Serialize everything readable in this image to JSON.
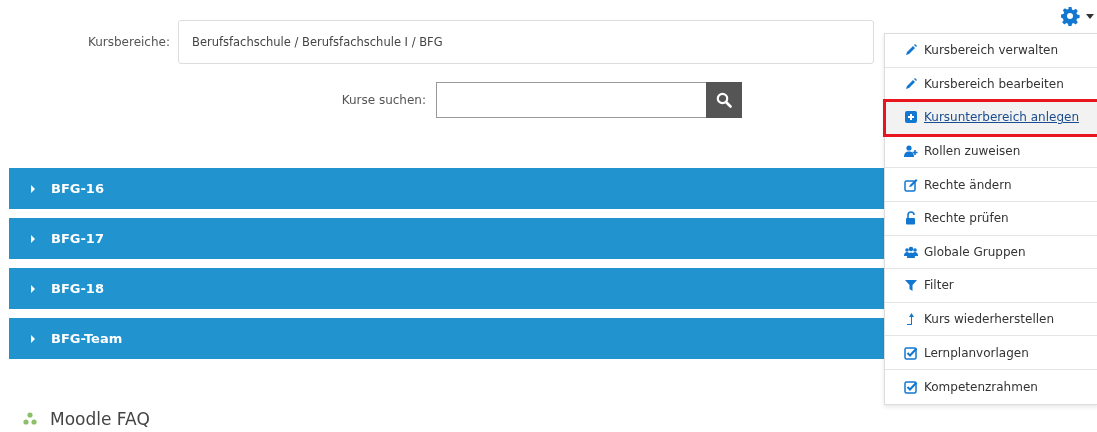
{
  "category_select": {
    "label": "Kursbereiche:",
    "value": "Berufsfachschule / Berufsfachschule I / BFG"
  },
  "course_search": {
    "label": "Kurse suchen:"
  },
  "categories": [
    {
      "name": "BFG-16",
      "expanded": false
    },
    {
      "name": "BFG-17",
      "expanded": false
    },
    {
      "name": "BFG-18",
      "expanded": false
    },
    {
      "name": "BFG-Team",
      "expanded": false
    }
  ],
  "section": {
    "title": "Moodle FAQ"
  },
  "settings_menu": {
    "expanded": true,
    "items": [
      {
        "label": "Kursbereich verwalten",
        "kind": "pencil",
        "highlighted": false
      },
      {
        "label": "Kursbereich bearbeiten",
        "kind": "pencil",
        "highlighted": false
      },
      {
        "label": "Kursunterbereich anlegen",
        "kind": "plus",
        "highlighted": true
      },
      {
        "label": "Rollen zuweisen",
        "kind": "userplus",
        "highlighted": false
      },
      {
        "label": "Rechte ändern",
        "kind": "edit",
        "highlighted": false
      },
      {
        "label": "Rechte prüfen",
        "kind": "unlock",
        "highlighted": false
      },
      {
        "label": "Globale Gruppen",
        "kind": "users",
        "highlighted": false
      },
      {
        "label": "Filter",
        "kind": "filter",
        "highlighted": false
      },
      {
        "label": "Kurs wiederherstellen",
        "kind": "levelup",
        "highlighted": false
      },
      {
        "label": "Lernplanvorlagen",
        "kind": "check",
        "highlighted": false
      },
      {
        "label": "Kompetenzrahmen",
        "kind": "check",
        "highlighted": false
      }
    ]
  }
}
